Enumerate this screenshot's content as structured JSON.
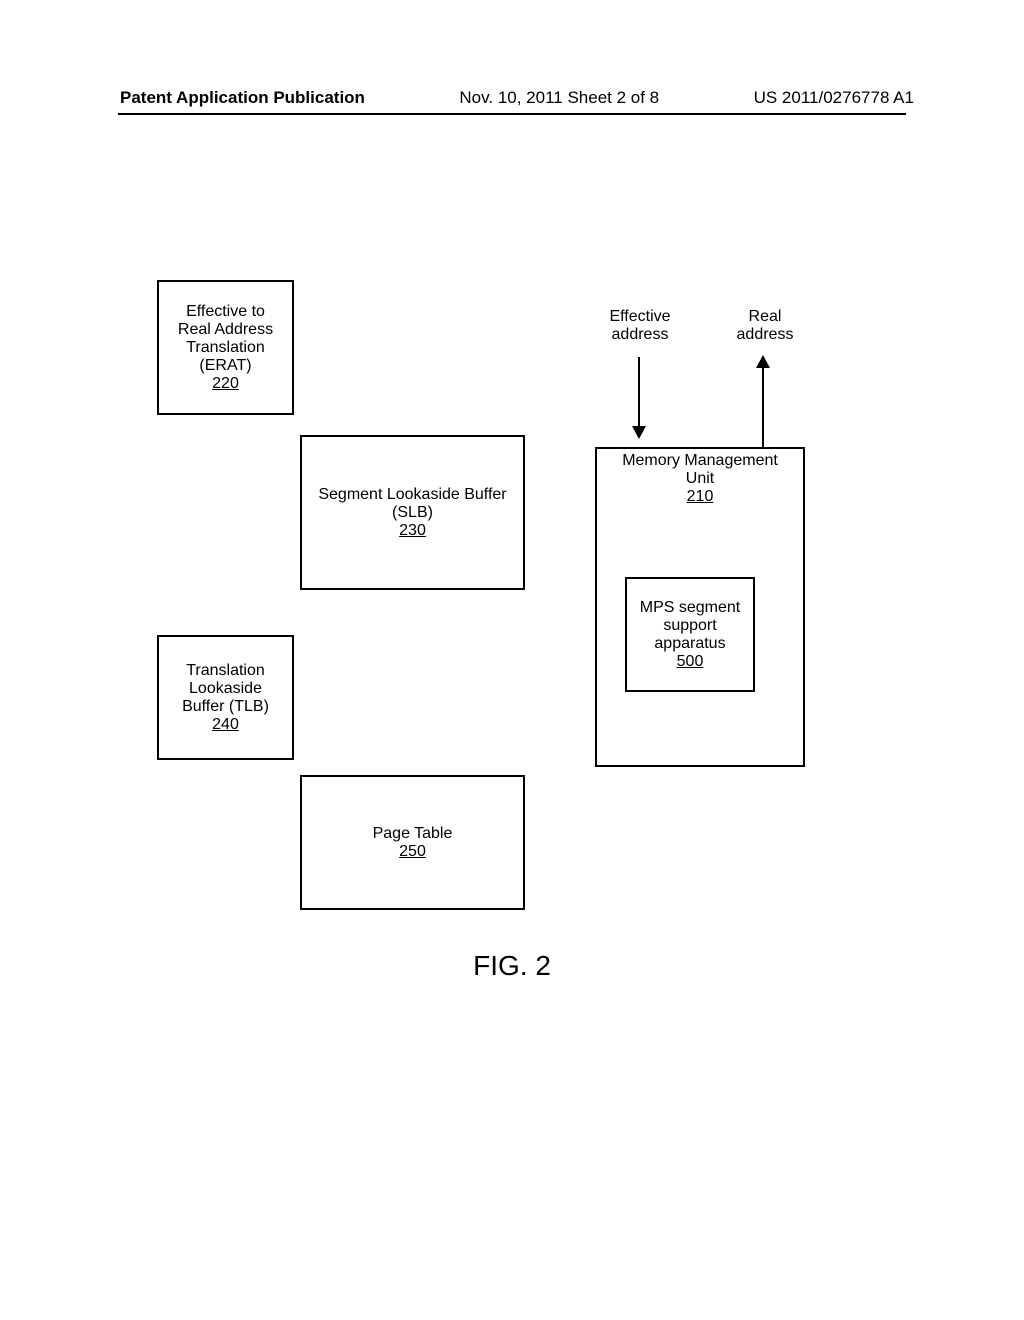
{
  "header": {
    "left": "Patent Application Publication",
    "center": "Nov. 10, 2011  Sheet 2 of 8",
    "right": "US 2011/0276778 A1"
  },
  "boxes": {
    "erat": {
      "line1": "Effective to",
      "line2": "Real Address",
      "line3": "Translation",
      "line4": "(ERAT)",
      "ref": "220"
    },
    "slb": {
      "line1": "Segment Lookaside Buffer",
      "line2": "(SLB)",
      "ref": "230"
    },
    "tlb": {
      "line1": "Translation",
      "line2": "Lookaside",
      "line3": "Buffer (TLB)",
      "ref": "240"
    },
    "pagetable": {
      "line1": "Page Table",
      "ref": "250"
    },
    "mmu": {
      "line1": "Memory Management",
      "line2": "Unit",
      "ref": "210"
    },
    "mps": {
      "line1": "MPS segment",
      "line2": "support",
      "line3": "apparatus",
      "ref": "500"
    }
  },
  "labels": {
    "effective": "Effective address",
    "real": "Real address"
  },
  "figure": "FIG. 2"
}
